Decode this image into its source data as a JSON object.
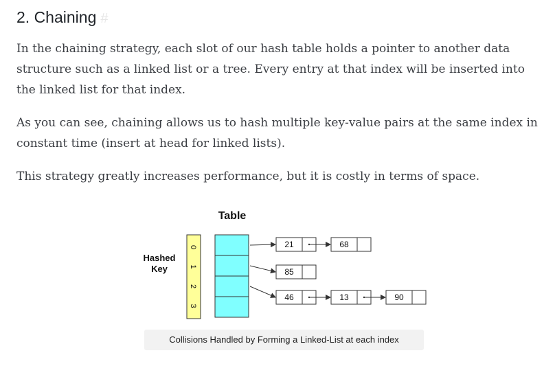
{
  "heading": {
    "text": "2. Chaining",
    "anchor": "#"
  },
  "paragraphs": [
    "In the chaining strategy, each slot of our hash table holds a pointer to another data structure such as a linked list or a tree. Every entry at that index will be inserted into the linked list for that index.",
    "As you can see, chaining allows us to hash multiple key-value pairs at the same index in constant time (insert at head for linked lists).",
    "This strategy greatly increases performance, but it is costly in terms of space."
  ],
  "diagram": {
    "title": "Table",
    "key_label_line1": "Hashed",
    "key_label_line2": "Key",
    "indices": [
      "0",
      "1",
      "2",
      "3"
    ],
    "chains": [
      [
        "21",
        "68"
      ],
      [
        "85"
      ],
      [
        "46",
        "13",
        "90"
      ],
      []
    ],
    "colors": {
      "key_fill": "#ffff99",
      "table_fill": "#80ffff",
      "stroke": "#333333"
    }
  },
  "caption": "Collisions Handled by Forming a Linked-List at each index"
}
